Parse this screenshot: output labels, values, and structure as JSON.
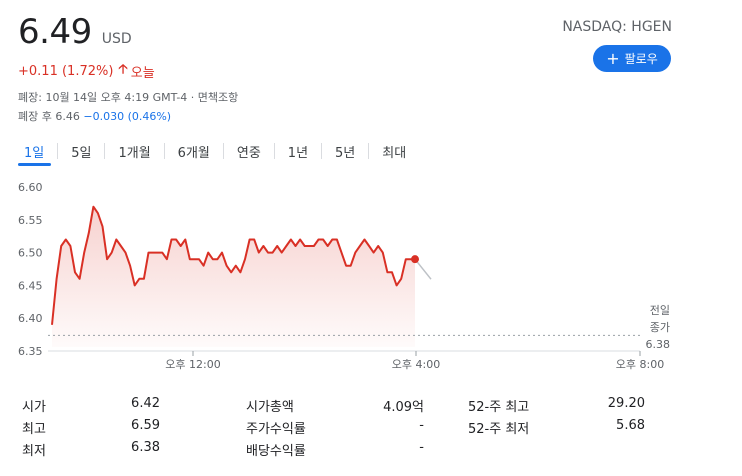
{
  "quote": {
    "price": "6.49",
    "currency": "USD",
    "exchange": "NASDAQ: HGEN",
    "change": "+0.11 (1.72%)",
    "change_icon": "arrow-up-icon",
    "today": "오늘",
    "close_info": "폐장: 10월 14일 오후 4:19 GMT-4 · 면책조항",
    "after_label": "폐장 후 6.46",
    "after_change": "−0.030 (0.46%)",
    "accent_color": "#1a73e8",
    "down_color": "#d93025"
  },
  "follow_button": {
    "icon": "plus-icon",
    "label": "팔로우"
  },
  "tabs": [
    {
      "label": "1일",
      "active": true
    },
    {
      "label": "5일",
      "active": false
    },
    {
      "label": "1개월",
      "active": false
    },
    {
      "label": "6개월",
      "active": false
    },
    {
      "label": "연중",
      "active": false
    },
    {
      "label": "1년",
      "active": false
    },
    {
      "label": "5년",
      "active": false
    },
    {
      "label": "최대",
      "active": false
    }
  ],
  "chart_data": {
    "type": "line",
    "y_ticks": [
      "6.60",
      "6.55",
      "6.50",
      "6.45",
      "6.40",
      "6.35"
    ],
    "ylim": [
      6.35,
      6.6
    ],
    "x_ticks": [
      "오후 12:00",
      "오후 4:00",
      "오후 8:00"
    ],
    "previous_close_label": [
      "전일",
      "종가",
      "6.38"
    ],
    "previous_close": 6.38,
    "line_color": "#d93025",
    "grid": false,
    "series": [
      {
        "values": [
          6.39,
          6.46,
          6.51,
          6.52,
          6.51,
          6.47,
          6.46,
          6.5,
          6.53,
          6.57,
          6.56,
          6.54,
          6.49,
          6.5,
          6.52,
          6.51,
          6.5,
          6.48,
          6.45,
          6.46,
          6.46,
          6.5,
          6.5,
          6.5,
          6.5,
          6.49,
          6.52,
          6.52,
          6.51,
          6.52,
          6.49,
          6.49,
          6.49,
          6.48,
          6.5,
          6.49,
          6.49,
          6.5,
          6.48,
          6.47,
          6.48,
          6.47,
          6.49,
          6.52,
          6.52,
          6.5,
          6.51,
          6.5,
          6.5,
          6.51,
          6.5,
          6.51,
          6.52,
          6.51,
          6.52,
          6.51,
          6.51,
          6.51,
          6.52,
          6.52,
          6.51,
          6.52,
          6.52,
          6.5,
          6.48,
          6.48,
          6.5,
          6.51,
          6.52,
          6.51,
          6.5,
          6.51,
          6.5,
          6.47,
          6.47,
          6.45,
          6.46,
          6.49,
          6.49,
          6.49
        ]
      }
    ]
  },
  "stats": [
    {
      "label": "시가",
      "value": "6.42"
    },
    {
      "label": "최고",
      "value": "6.59"
    },
    {
      "label": "최저",
      "value": "6.38"
    },
    {
      "label": "시가총액",
      "value": "4.09억"
    },
    {
      "label": "주가수익률",
      "value": "-"
    },
    {
      "label": "배당수익률",
      "value": "-"
    },
    {
      "label": "52-주 최고",
      "value": "29.20"
    },
    {
      "label": "52-주 최저",
      "value": "5.68"
    }
  ]
}
